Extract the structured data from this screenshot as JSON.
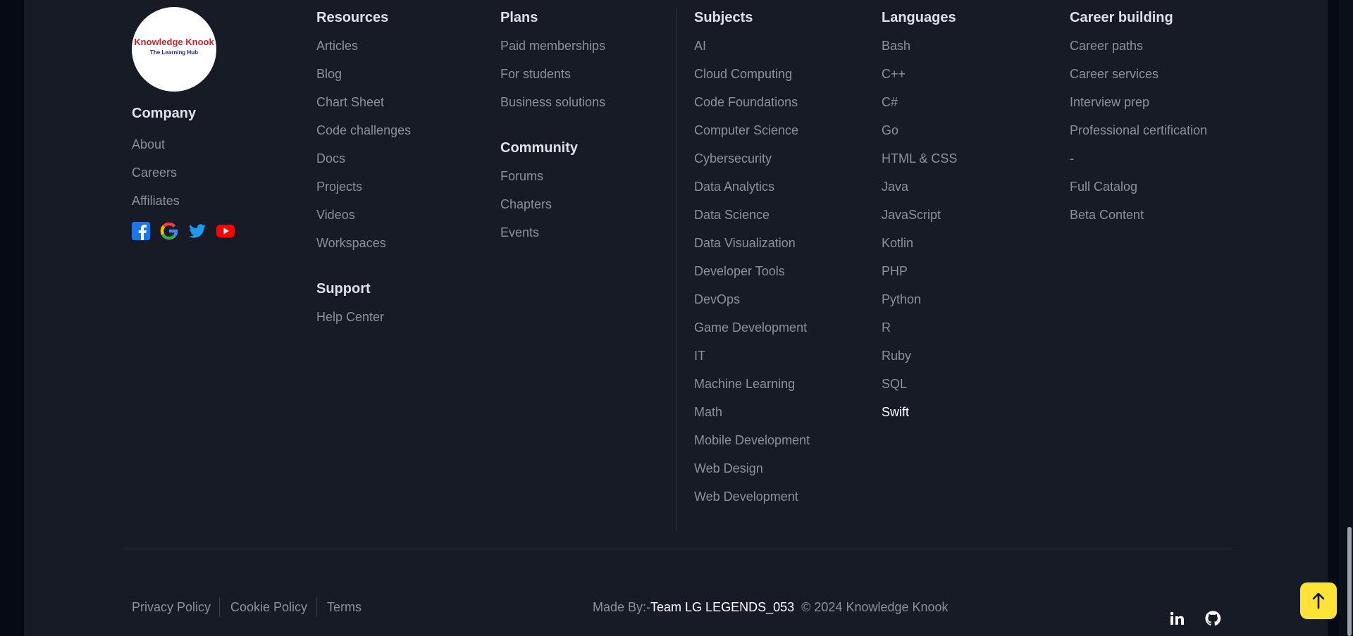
{
  "logo": {
    "line1": "Knowledge Knook",
    "line2": "The Learning Hub"
  },
  "company": {
    "heading": "Company",
    "links": [
      "About",
      "Careers",
      "Affiliates"
    ]
  },
  "social_icons": [
    "facebook-icon",
    "google-icon",
    "twitter-icon",
    "youtube-icon"
  ],
  "resources": {
    "heading": "Resources",
    "links": [
      "Articles",
      "Blog",
      "Chart Sheet",
      "Code challenges",
      "Docs",
      "Projects",
      "Videos",
      "Workspaces"
    ]
  },
  "support": {
    "heading": "Support",
    "links": [
      "Help Center"
    ]
  },
  "plans": {
    "heading": "Plans",
    "links": [
      "Paid memberships",
      "For students",
      "Business solutions"
    ]
  },
  "community": {
    "heading": "Community",
    "links": [
      "Forums",
      "Chapters",
      "Events"
    ]
  },
  "subjects": {
    "heading": "Subjects",
    "links": [
      "AI",
      "Cloud Computing",
      "Code Foundations",
      "Computer Science",
      "Cybersecurity",
      "Data Analytics",
      "Data Science",
      "Data Visualization",
      "Developer Tools",
      "DevOps",
      "Game Development",
      "IT",
      "Machine Learning",
      "Math",
      "Mobile Development",
      "Web Design",
      "Web Development"
    ]
  },
  "languages": {
    "heading": "Languages",
    "links": [
      "Bash",
      "C++",
      "C#",
      "Go",
      "HTML & CSS",
      "Java",
      "JavaScript",
      "Kotlin",
      "PHP",
      "Python",
      "R",
      "Ruby",
      "SQL",
      "Swift"
    ],
    "highlighted": "Swift"
  },
  "career": {
    "heading": "Career building",
    "links": [
      "Career paths",
      "Career services",
      "Interview prep",
      "Professional certification",
      "-",
      "Full Catalog",
      "Beta Content"
    ]
  },
  "footer": {
    "legal_links": [
      "Privacy Policy",
      "Cookie Policy",
      "Terms"
    ],
    "made_by_label": "Made By:-",
    "team": "Team LG LEGENDS_053",
    "copyright": "© 2024 Knowledge Knook"
  },
  "colors": {
    "background": "#161b26",
    "heading": "#dfe1e5",
    "link": "#8c9199",
    "accent_button": "#ffe335",
    "logo_red": "#d3202a"
  }
}
